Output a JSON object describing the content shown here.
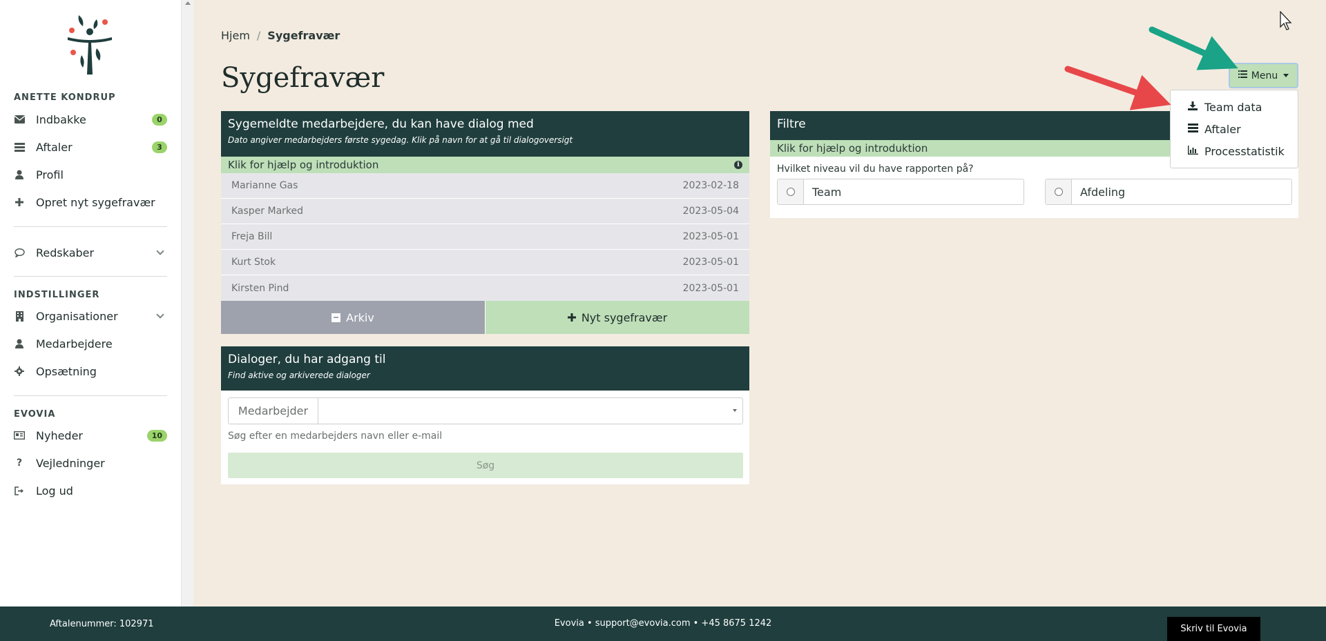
{
  "sidebar": {
    "user_name": "ANETTE KONDRUP",
    "main_items": [
      {
        "label": "Indbakke",
        "icon": "envelope-icon",
        "badge": "0"
      },
      {
        "label": "Aftaler",
        "icon": "list-icon",
        "badge": "3"
      },
      {
        "label": "Profil",
        "icon": "user-icon"
      },
      {
        "label": "Opret nyt sygefravær",
        "icon": "plus-icon"
      }
    ],
    "tools_item": {
      "label": "Redskaber",
      "icon": "speech-bubble-icon"
    },
    "settings_title": "INDSTILLINGER",
    "settings_items": [
      {
        "label": "Organisationer",
        "icon": "building-icon"
      },
      {
        "label": "Medarbejdere",
        "icon": "user-icon"
      },
      {
        "label": "Opsætning",
        "icon": "gear-icon"
      }
    ],
    "evovia_title": "EVOVIA",
    "evovia_items": [
      {
        "label": "Nyheder",
        "icon": "newspaper-icon",
        "badge": "10"
      },
      {
        "label": "Vejledninger",
        "icon": "question-icon"
      },
      {
        "label": "Log ud",
        "icon": "logout-icon"
      }
    ]
  },
  "breadcrumb": {
    "home": "Hjem",
    "separator": "/",
    "current": "Sygefravær"
  },
  "page_title": "Sygefravær",
  "menu": {
    "label": "Menu",
    "items": [
      {
        "label": "Team data",
        "icon": "download-icon"
      },
      {
        "label": "Aftaler",
        "icon": "list-icon"
      },
      {
        "label": "Processtatistik",
        "icon": "bar-chart-icon"
      }
    ]
  },
  "sick_card": {
    "title": "Sygemeldte medarbejdere, du kan have dialog med",
    "subtitle": "Dato angiver medarbejders første sygedag. Klik på navn for at gå til dialogoversigt",
    "help": "Klik for hjælp og introduktion",
    "rows": [
      {
        "name": "Marianne Gas",
        "date": "2023-02-18"
      },
      {
        "name": "Kasper Marked",
        "date": "2023-05-04"
      },
      {
        "name": "Freja Bill",
        "date": "2023-05-01"
      },
      {
        "name": "Kurt Stok",
        "date": "2023-05-01"
      },
      {
        "name": "Kirsten Pind",
        "date": "2023-05-01"
      }
    ],
    "archive_label": "Arkiv",
    "new_label": "Nyt sygefravær"
  },
  "dialog_card": {
    "title": "Dialoger, du har adgang til",
    "subtitle": "Find aktive og arkiverede dialoger",
    "field_label": "Medarbejder",
    "hint": "Søg efter en medarbejders navn eller e-mail",
    "search_label": "Søg"
  },
  "filter_card": {
    "title": "Filtre",
    "help": "Klik for hjælp og introduktion",
    "question": "Hvilket niveau vil du have rapporten på?",
    "options": [
      "Team",
      "Afdeling"
    ]
  },
  "footer": {
    "agreement": "Aftalenummer: 102971",
    "contact": "Evovia • support@evovia.com • +45 8675 1242",
    "write_button": "Skriv til Evovia"
  },
  "colors": {
    "dark_green": "#1f3e3d",
    "light_green": "#bedfb8",
    "background": "#f3ebe0",
    "badge_green": "#9bd36b",
    "arrow_red": "#e8474a",
    "arrow_teal": "#1aa386"
  }
}
